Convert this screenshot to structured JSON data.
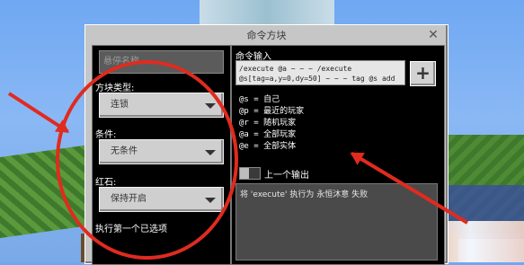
{
  "dialog": {
    "title": "命令方块",
    "close_glyph": "✕"
  },
  "left": {
    "name_placeholder": "悬停名称",
    "block_type_label": "方块类型:",
    "block_type_value": "连锁",
    "condition_label": "条件:",
    "condition_value": "无条件",
    "redstone_label": "红石:",
    "redstone_value": "保持开启",
    "execute_first_label": "执行第一个已选项"
  },
  "right": {
    "command_label": "命令输入",
    "command_text": "/execute @a ~ ~ ~ /execute @s[tag=a,y=0,dy=50] ~ ~ ~ tag @s add b",
    "add_button": "+",
    "help": [
      "@s = 自己",
      "@p = 最近的玩家",
      "@r = 随机玩家",
      "@a = 全部玩家",
      "@e = 全部实体"
    ],
    "previous_output_label": "上一个输出",
    "output_text": "将 'execute' 执行为 永恒沐意 失败"
  },
  "colors": {
    "annotation": "#e02b1f",
    "panel_bg": "#000000",
    "dialog_bg": "#c6c6c6"
  }
}
